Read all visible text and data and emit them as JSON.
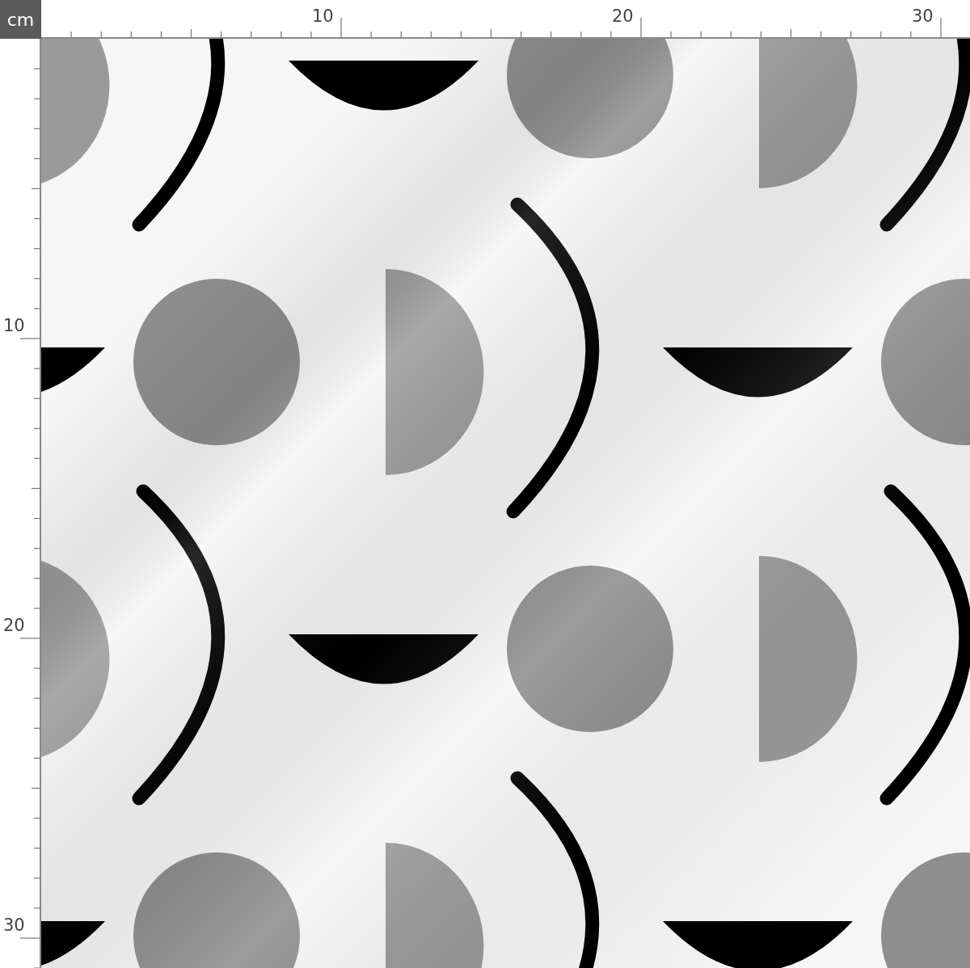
{
  "ruler": {
    "unit": "cm",
    "top_labels": [
      "10",
      "20",
      "30"
    ],
    "left_labels": [
      "10",
      "20",
      "30"
    ]
  }
}
